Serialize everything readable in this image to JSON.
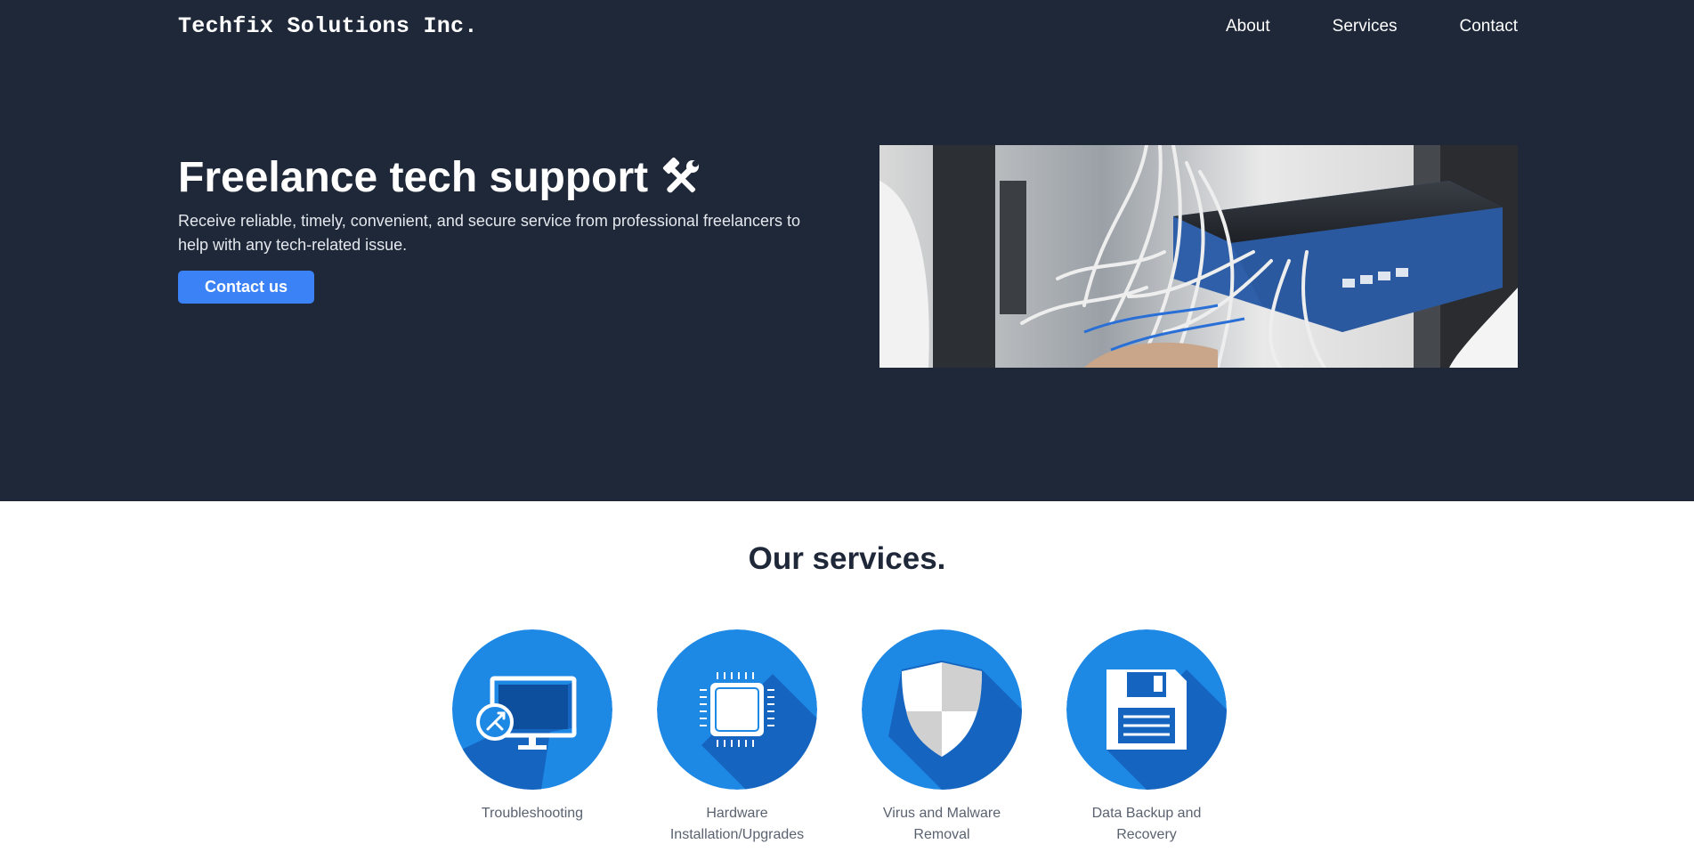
{
  "header": {
    "brand": "Techfix Solutions Inc.",
    "nav": [
      {
        "label": "About"
      },
      {
        "label": "Services"
      },
      {
        "label": "Contact"
      }
    ]
  },
  "hero": {
    "title": "Freelance tech support",
    "title_icon": "hammer-wrench-icon",
    "description": "Receive reliable, timely, convenient, and secure service from professional freelancers to help with any tech-related issue.",
    "cta_label": "Contact us",
    "image": "network-switch-cables-photo"
  },
  "services": {
    "title": "Our services.",
    "items": [
      {
        "label": "Troubleshooting",
        "icon": "remote-desktop-monitor-icon"
      },
      {
        "label": "Hardware Installation/Upgrades",
        "icon": "cpu-chip-icon"
      },
      {
        "label": "Virus and Malware Removal",
        "icon": "shield-icon"
      },
      {
        "label": "Data Backup and Recovery",
        "icon": "floppy-disk-icon"
      }
    ]
  },
  "colors": {
    "hero_bg": "#1f2838",
    "accent": "#3b82f6",
    "service_circle": "#1e88e5",
    "service_shadow": "#1565c0",
    "title_text": "#1f2838",
    "label_text": "#5a6270"
  }
}
